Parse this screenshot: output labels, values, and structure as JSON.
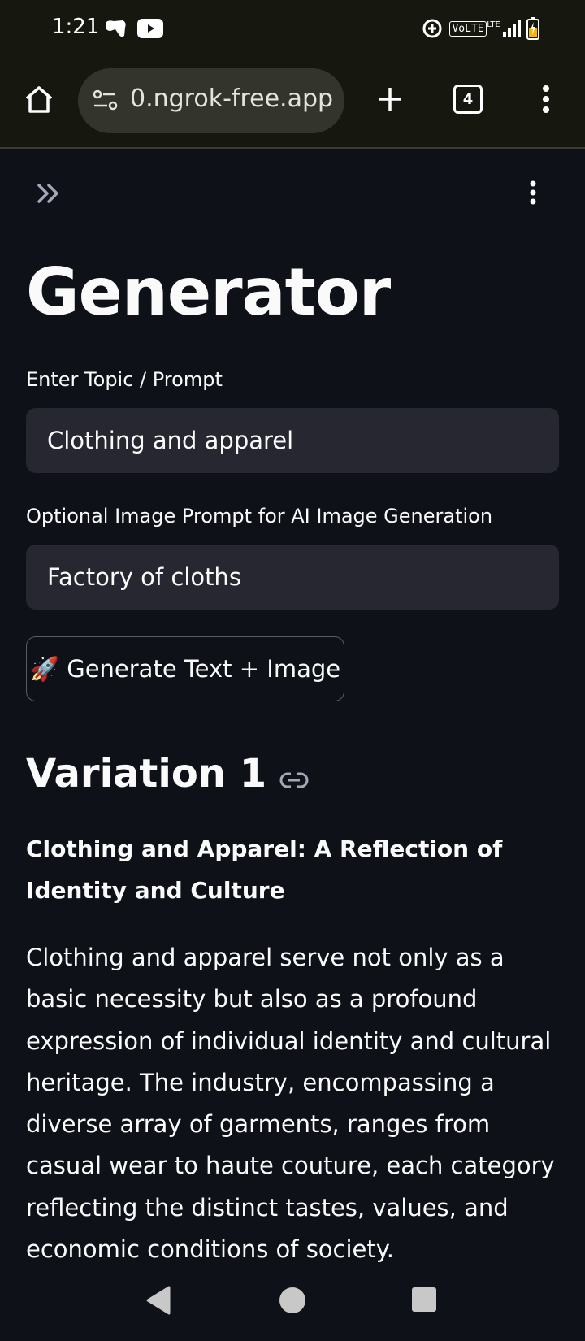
{
  "status_bar": {
    "time": "1:21",
    "icons": [
      "app-notification-icon",
      "youtube-icon",
      "data-saver-icon",
      "volte-icon",
      "lte-signal-icon",
      "battery-icon"
    ],
    "volte_text": "VoLTE",
    "lte_text": "LTE"
  },
  "browser": {
    "url": "0.ngrok-free.app",
    "tab_count": "4"
  },
  "app": {
    "title": "Generator",
    "topic_label": "Enter Topic / Prompt",
    "topic_value": "Clothing and apparel",
    "image_prompt_label": "Optional Image Prompt for AI Image Generation",
    "image_prompt_value": "Factory of cloths",
    "generate_button": "🚀 Generate Text + Image",
    "variation_heading": "Variation 1",
    "variation_subhead": "Clothing and Apparel: A Reflection of Identity and Culture",
    "variation_body": "Clothing and apparel serve not only as a basic necessity but also as a profound expression of individual identity and cultural heritage. The industry, encompassing a diverse array of garments, ranges from casual wear to haute couture, each category reflecting the distinct tastes, values, and economic conditions of society."
  },
  "colors": {
    "page_bg": "#0e1117",
    "input_bg": "#262730",
    "chrome_bg": "#16170f",
    "text": "#fafafa"
  }
}
